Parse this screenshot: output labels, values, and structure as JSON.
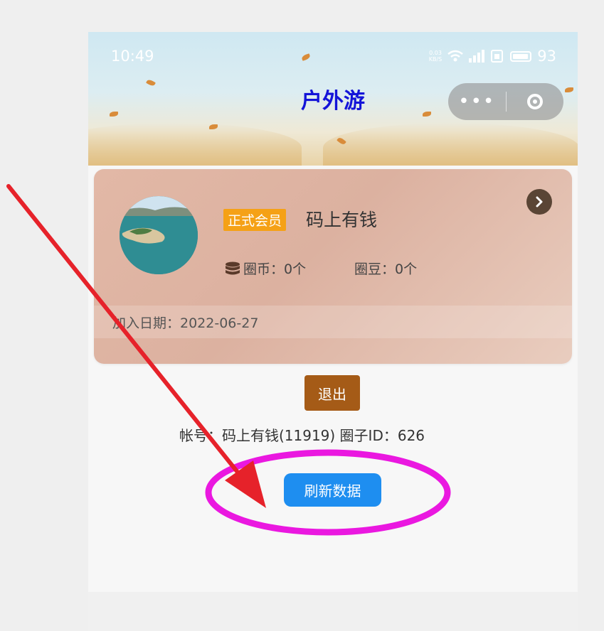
{
  "status_bar": {
    "time": "10:49",
    "net_speed_value": "0.03",
    "net_speed_unit": "KB/S",
    "battery": "93"
  },
  "header": {
    "title": "户外游",
    "more_glyph": "•••",
    "capsule_icons": [
      "more-dots-icon",
      "close-ring-icon"
    ]
  },
  "profile": {
    "member_badge": "正式会员",
    "nickname": "码上有钱",
    "coins_label": "圈币：0个",
    "beans_label": "圈豆：0个",
    "join_date": "加入日期：2022-06-27"
  },
  "actions": {
    "logout_label": "退出",
    "account_info": "帐号：码上有钱(11919) 圈子ID：626",
    "refresh_label": "刷新数据"
  },
  "colors": {
    "title": "#1414d8",
    "badge": "#f5a116",
    "logout": "#a55b17",
    "refresh": "#1e8ef0",
    "arrow": "#e6222a",
    "ellipse": "#ea18e0"
  }
}
